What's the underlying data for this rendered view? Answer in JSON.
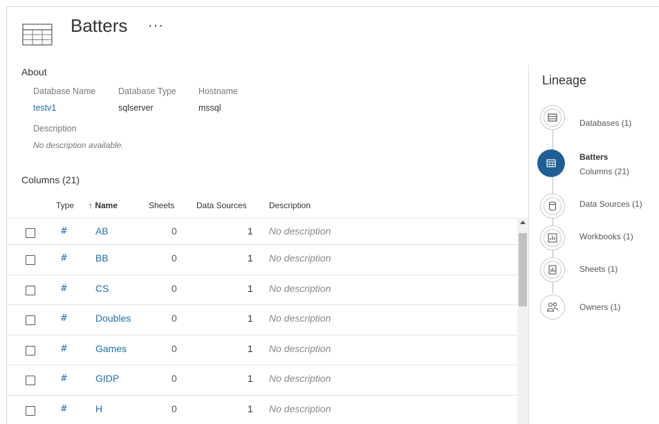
{
  "header": {
    "title": "Batters",
    "more_label": "···"
  },
  "about": {
    "heading": "About",
    "fields": [
      {
        "label": "Database Name",
        "value": "testv1"
      },
      {
        "label": "Database Type",
        "value": "sqlserver"
      },
      {
        "label": "Hostname",
        "value": "mssql"
      }
    ],
    "description_label": "Description",
    "description_value": "No description available."
  },
  "columns": {
    "heading": "Columns (21)",
    "headers": {
      "type": "Type",
      "name": "↑ Name",
      "sheets": "Sheets",
      "data_sources": "Data Sources",
      "description": "Description"
    },
    "type_glyph": "#",
    "rows": [
      {
        "name": "AB",
        "sheets": "0",
        "data_sources": "1",
        "description": "No description"
      },
      {
        "name": "BB",
        "sheets": "0",
        "data_sources": "1",
        "description": "No description"
      },
      {
        "name": "CS",
        "sheets": "0",
        "data_sources": "1",
        "description": "No description"
      },
      {
        "name": "Doubles",
        "sheets": "0",
        "data_sources": "1",
        "description": "No description"
      },
      {
        "name": "Games",
        "sheets": "0",
        "data_sources": "1",
        "description": "No description"
      },
      {
        "name": "GIDP",
        "sheets": "0",
        "data_sources": "1",
        "description": "No description"
      },
      {
        "name": "H",
        "sheets": "0",
        "data_sources": "1",
        "description": "No description"
      }
    ]
  },
  "lineage": {
    "title": "Lineage",
    "nodes": [
      {
        "label": "Databases (1)",
        "icon": "database-icon"
      },
      {
        "label": "Batters",
        "sublabel": "Columns (21)",
        "icon": "table-icon",
        "active": true
      },
      {
        "label": "Data Sources (1)",
        "icon": "data-source-icon"
      },
      {
        "label": "Workbooks (1)",
        "icon": "workbook-icon"
      },
      {
        "label": "Sheets (1)",
        "icon": "sheet-icon"
      },
      {
        "label": "Owners (1)",
        "icon": "owners-icon"
      }
    ]
  },
  "colors": {
    "link": "#1f6fa7",
    "active_node": "#1f5f94"
  }
}
